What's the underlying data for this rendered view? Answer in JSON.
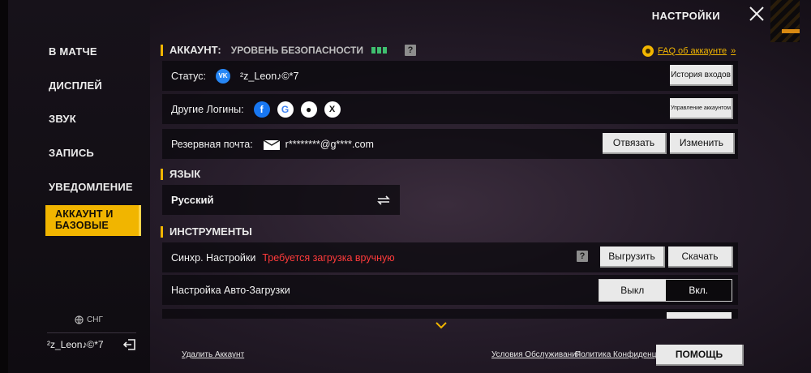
{
  "header": {
    "title": "НАСТРОЙКИ",
    "close_icon": "close-icon"
  },
  "sidebar": {
    "items": [
      {
        "label": "В МАТЧЕ"
      },
      {
        "label": "ДИСПЛЕЙ"
      },
      {
        "label": "ЗВУК"
      },
      {
        "label": "ЗАПИСЬ"
      },
      {
        "label": "УВЕДОМЛЕНИЕ"
      },
      {
        "label": "АККАУНТ И БАЗОВЫЕ",
        "active": true
      }
    ],
    "region": "СНГ",
    "username": "²z_Leon♪©*7"
  },
  "account": {
    "header": "АККАУНТ:",
    "security_label": "УРОВЕНЬ БЕЗОПАСНОСТИ",
    "faq_link": "FAQ об аккаунте",
    "status_label": "Статус:",
    "status_value": "²z_Leon♪©*7",
    "login_history_button": "История входов",
    "other_logins_label": "Другие Логины:",
    "manage_account_button": "Управление аккаунтом",
    "backup_email_label": "Резервная почта:",
    "backup_email_value": "r********@g****.com",
    "unbind_button": "Отвязать",
    "change_button": "Изменить"
  },
  "language": {
    "header": "ЯЗЫК",
    "current": "Русский"
  },
  "tools": {
    "header": "ИНСТРУМЕНТЫ",
    "sync_label": "Синхр. Настройки",
    "sync_warning": "Требуется загрузка вручную",
    "upload_button": "Выгрузить",
    "download_button": "Скачать",
    "auto_download_label": "Настройка Авто-Загрузки",
    "toggle_off": "Выкл",
    "toggle_on": "Вкл."
  },
  "footer": {
    "delete_account": "Удалить Аккаунт",
    "terms": "Условия Обслуживания",
    "privacy": "Политика Конфиденц.",
    "help_button": "ПОМОЩЬ"
  },
  "colors": {
    "accent": "#f1b500",
    "warning": "#ff3b3b",
    "security_level": "#3fbf6f"
  }
}
